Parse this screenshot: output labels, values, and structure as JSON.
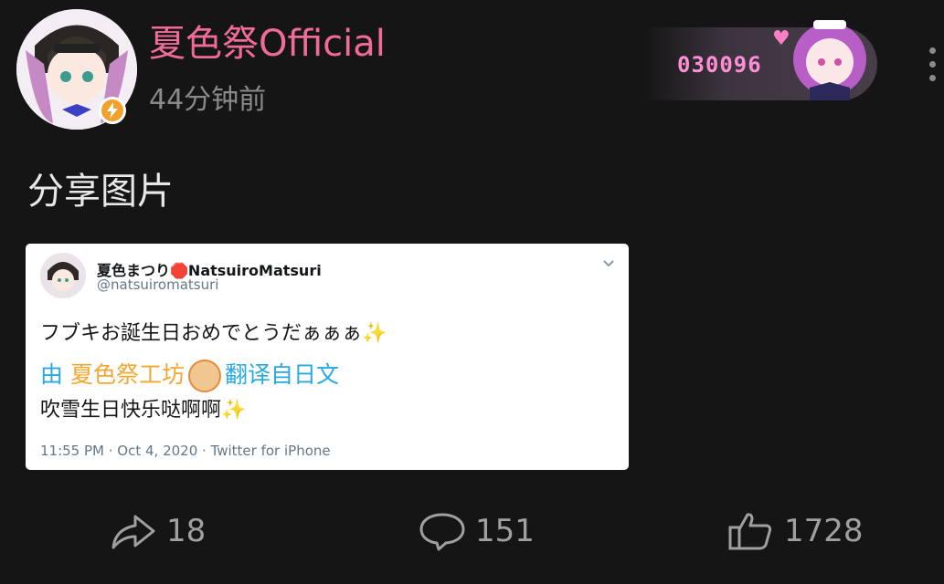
{
  "post": {
    "username": "夏色祭Official",
    "time_ago": "44分钟前",
    "medal_count": "030096",
    "text": "分享图片"
  },
  "tweet": {
    "display_name": "夏色まつり🛑NatsuiroMatsuri",
    "handle": "@natsuiromatsuri",
    "line1": "フブキお誕生日おめでとうだぁぁぁ",
    "line2_prefix": "由",
    "line2_studio": "夏色祭工坊",
    "line2_suffix": "翻译自日文",
    "line3": "吹雪生日快乐哒啊啊",
    "meta": "11:55 PM · Oct 4, 2020 · Twitter for iPhone",
    "sparkle": "✨"
  },
  "actions": {
    "share_count": "18",
    "comment_count": "151",
    "like_count": "1728"
  },
  "icons": [
    "verified-bolt-icon",
    "more-vertical-icon",
    "chevron-down-icon",
    "share-icon",
    "comment-icon",
    "like-icon"
  ],
  "colors": {
    "username": "#f06b97",
    "medal_text": "#ff8ed6",
    "link_blue": "#28a9e0",
    "studio_orange": "#f3a72f"
  }
}
